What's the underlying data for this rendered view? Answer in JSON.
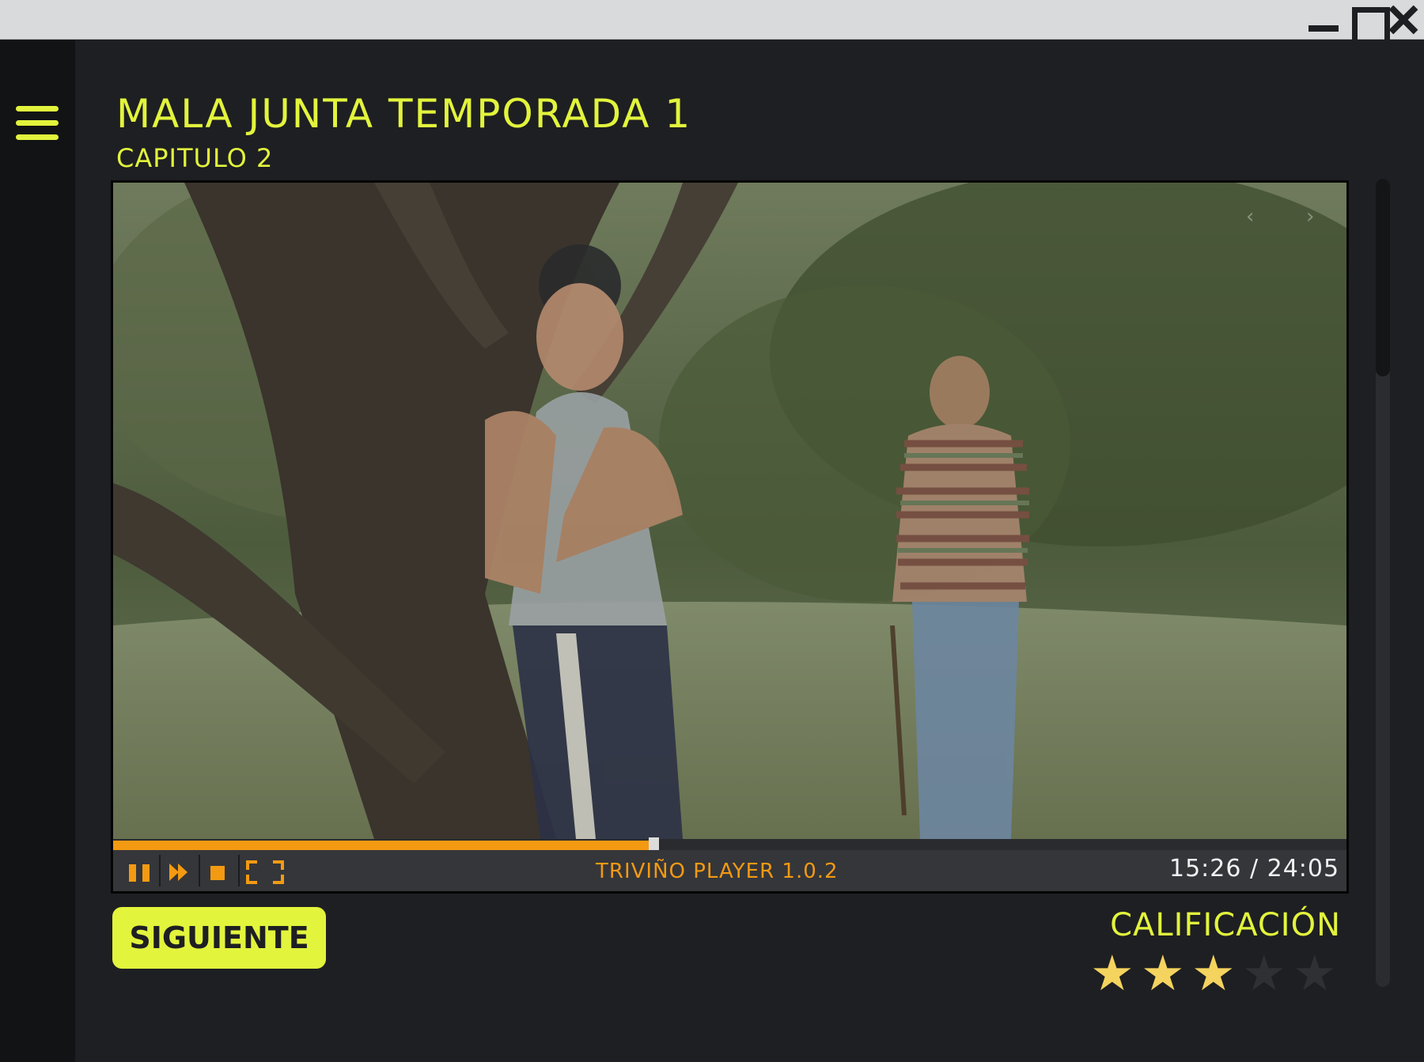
{
  "window": {
    "minimize_icon": "minimize-icon",
    "maximize_icon": "maximize-icon",
    "close_icon": "close-icon"
  },
  "sidebar": {
    "menu_icon": "hamburger-menu-icon"
  },
  "content": {
    "title": "MALA JUNTA TEMPORADA 1",
    "episode": "CAPITULO 2"
  },
  "player": {
    "name": "TRIVIÑO PLAYER 1.0.2",
    "time_display": "15:26 / 24:05",
    "progress": 0.438,
    "controls": [
      "pause-icon",
      "fast-forward-icon",
      "stop-icon",
      "fullscreen-icon"
    ],
    "nav": {
      "prev": "‹",
      "next": "›"
    }
  },
  "next_button": {
    "label": "SIGUIENTE"
  },
  "rating": {
    "label": "CALIFICACIÓN",
    "value": 3,
    "max": 5,
    "filled_color": "#f4d35e",
    "empty_color": "#2f3033"
  },
  "colors": {
    "accent": "#e2f43c",
    "player_accent": "#f39a12",
    "background": "#1e1f22",
    "sidebar": "#121314"
  }
}
